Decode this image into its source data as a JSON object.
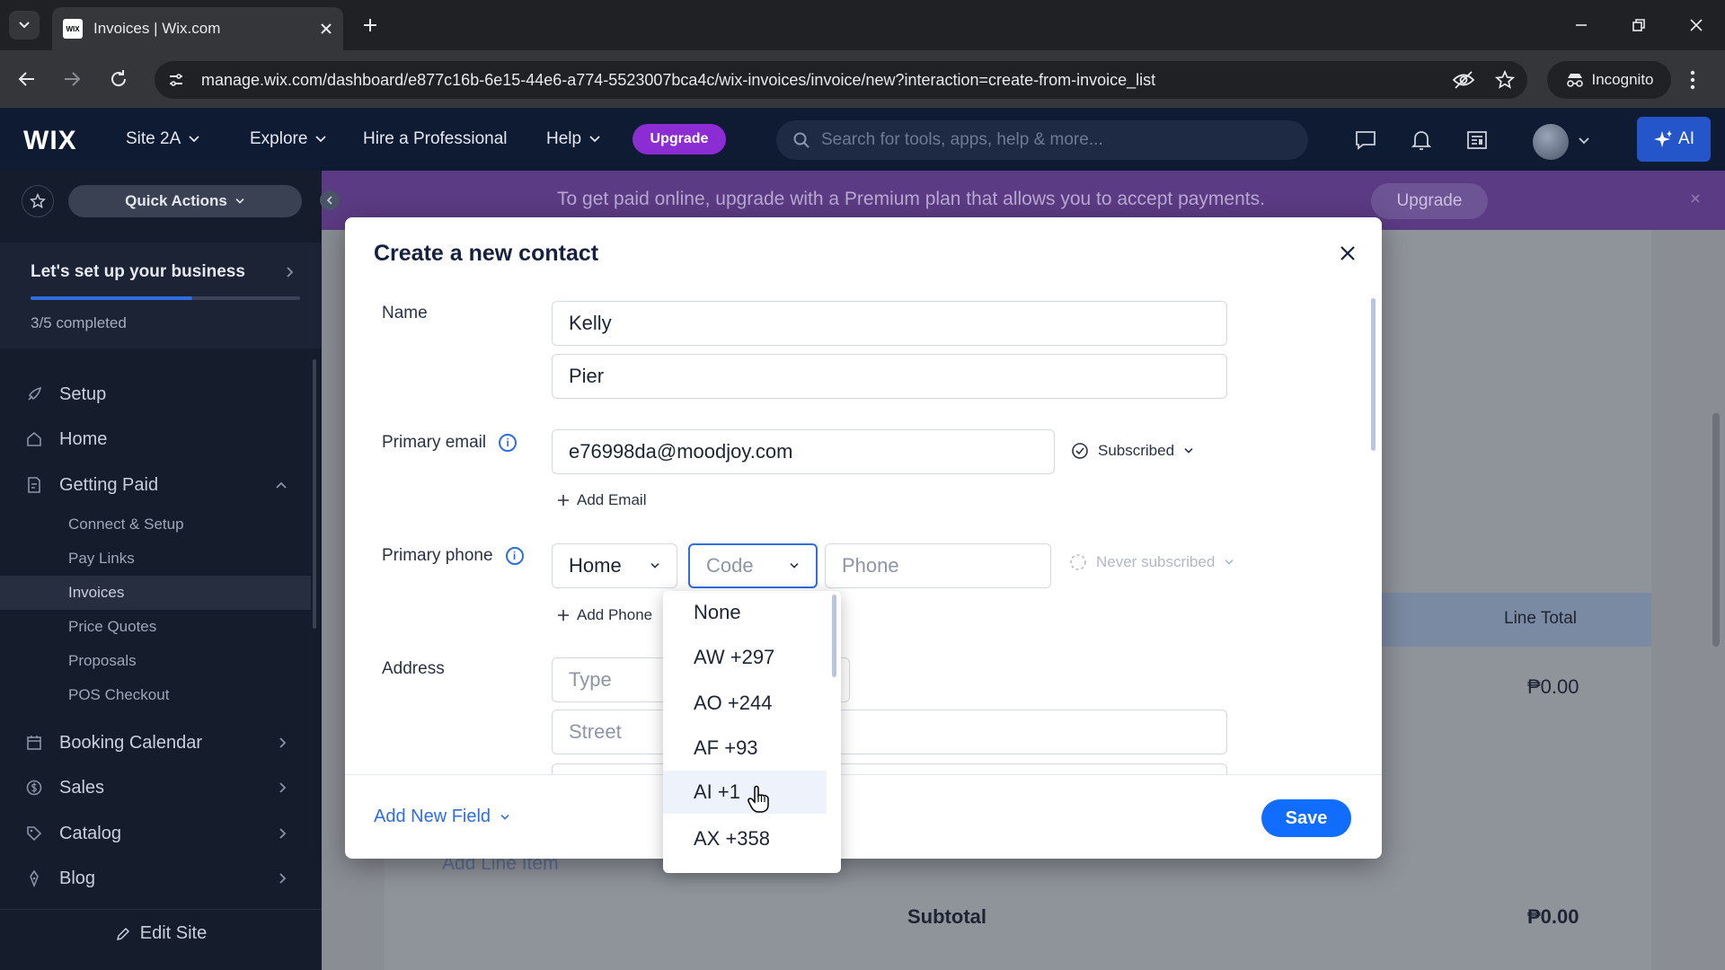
{
  "browser": {
    "tab_title": "Invoices | Wix.com",
    "favicon_text": "WIX",
    "url": "manage.wix.com/dashboard/e877c16b-6e15-44e6-a774-5523007bca4c/wix-invoices/invoice/new?interaction=create-from-invoice_list",
    "incognito_label": "Incognito"
  },
  "wix_header": {
    "logo": "WIX",
    "site_selector": "Site 2A",
    "explore": "Explore",
    "hire": "Hire a Professional",
    "help": "Help",
    "upgrade": "Upgrade",
    "search_placeholder": "Search for tools, apps, help & more...",
    "ai_label": "AI"
  },
  "sidebar": {
    "quick_actions": "Quick Actions",
    "setup_title": "Let's set up your business",
    "setup_progress_fraction": 0.6,
    "setup_count": "3/5 completed",
    "items": [
      {
        "label": "Setup"
      },
      {
        "label": "Home"
      },
      {
        "label": "Getting Paid"
      },
      {
        "label": "Booking Calendar"
      },
      {
        "label": "Sales"
      },
      {
        "label": "Catalog"
      },
      {
        "label": "Blog"
      }
    ],
    "sub_items": [
      {
        "label": "Connect & Setup"
      },
      {
        "label": "Pay Links"
      },
      {
        "label": "Invoices"
      },
      {
        "label": "Price Quotes"
      },
      {
        "label": "Proposals"
      },
      {
        "label": "POS Checkout"
      }
    ],
    "edit_site": "Edit Site"
  },
  "banner": {
    "text": "To get paid online, upgrade with a Premium plan that allows you to accept payments.",
    "upgrade": "Upgrade"
  },
  "background": {
    "line_total": "Line Total",
    "amount": "₱0.00",
    "subtotal": "Subtotal",
    "subtotal_amount": "₱0.00",
    "add_line_item": "Add Line Item"
  },
  "modal": {
    "title": "Create a new contact",
    "name_label": "Name",
    "first_name": "Kelly",
    "last_name": "Pier",
    "email_label": "Primary email",
    "email_value": "e76998da@moodjoy.com",
    "email_status": "Subscribed",
    "add_email": "Add Email",
    "phone_label": "Primary phone",
    "phone_type": "Home",
    "code_placeholder": "Code",
    "phone_placeholder": "Phone",
    "phone_status": "Never subscribed",
    "add_phone": "Add Phone",
    "address_label": "Address",
    "type_placeholder": "Type",
    "street_placeholder": "Street",
    "add_new_field": "Add New Field",
    "save": "Save"
  },
  "code_dropdown": {
    "options": [
      "None",
      "AW +297",
      "AO +244",
      "AF +93",
      "AI +1",
      "AX +358"
    ],
    "hovered": "AI +1"
  }
}
